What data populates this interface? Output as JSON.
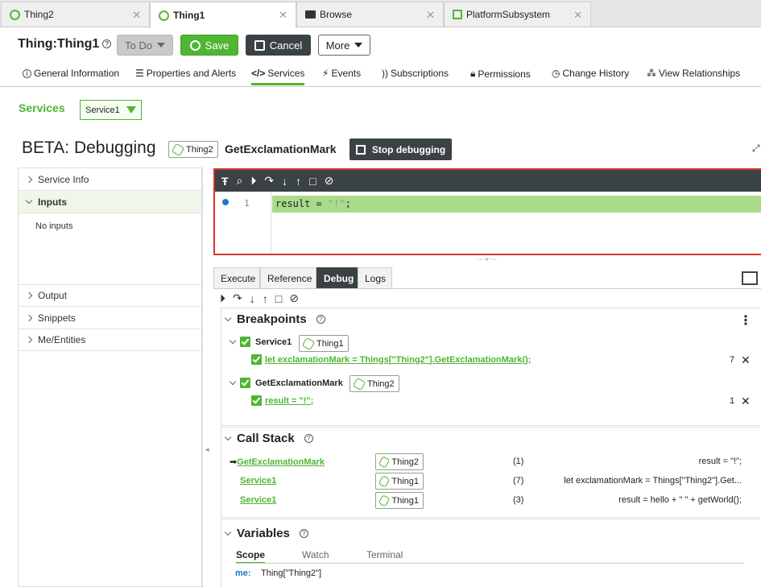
{
  "browser_tabs": [
    {
      "label": "Thing2",
      "icon": "thing-icon",
      "active": false
    },
    {
      "label": "Thing1",
      "icon": "thing-icon",
      "active": true
    },
    {
      "label": "Browse",
      "icon": "folder-icon",
      "active": false
    },
    {
      "label": "PlatformSubsystem",
      "icon": "subsystem-icon",
      "active": false
    }
  ],
  "header": {
    "title": "Thing:Thing1",
    "todo_label": "To Do",
    "save_label": "Save",
    "cancel_label": "Cancel",
    "more_label": "More"
  },
  "subnav": [
    {
      "label": "General Information",
      "icon": "info-icon"
    },
    {
      "label": "Properties and Alerts",
      "icon": "list-icon"
    },
    {
      "label": "Services",
      "icon": "code-icon",
      "active": true
    },
    {
      "label": "Events",
      "icon": "bolt-icon"
    },
    {
      "label": "Subscriptions",
      "icon": "rss-icon"
    },
    {
      "label": "Permissions",
      "icon": "lock-icon"
    },
    {
      "label": "Change History",
      "icon": "clock-icon"
    },
    {
      "label": "View Relationships",
      "icon": "relationship-icon"
    }
  ],
  "services": {
    "label": "Services",
    "selected": "Service1"
  },
  "debug": {
    "title": "BETA: Debugging",
    "thing": "Thing2",
    "method": "GetExclamationMark",
    "stop_label": "Stop debugging"
  },
  "left_panel": {
    "service_info": "Service Info",
    "inputs": "Inputs",
    "no_inputs": "No inputs",
    "output": "Output",
    "snippets": "Snippets",
    "me_entities": "Me/Entities"
  },
  "editor": {
    "line_number": "1",
    "code_prefix": "result = ",
    "code_string": "\"!\"",
    "code_suffix": ";"
  },
  "debug_tabs": [
    "Execute",
    "Reference",
    "Debug",
    "Logs"
  ],
  "breakpoints": {
    "title": "Breakpoints",
    "groups": [
      {
        "service": "Service1",
        "thing": "Thing1",
        "code": "let exclamationMark = Things[\"Thing2\"].GetExclamationMark();",
        "line": "7"
      },
      {
        "service": "GetExclamationMark",
        "thing": "Thing2",
        "code": "result = \"!\";",
        "line": "1"
      }
    ]
  },
  "call_stack": {
    "title": "Call Stack",
    "frames": [
      {
        "name": "GetExclamationMark",
        "thing": "Thing2",
        "line": "(1)",
        "code": "result = \"!\";",
        "current": true
      },
      {
        "name": "Service1",
        "thing": "Thing1",
        "line": "(7)",
        "code": "let exclamationMark = Things[\"Thing2\"].Get...",
        "current": false
      },
      {
        "name": "Service1",
        "thing": "Thing1",
        "line": "(3)",
        "code": "result = hello + \" \" + getWorld();",
        "current": false
      }
    ]
  },
  "variables": {
    "title": "Variables",
    "tabs": [
      "Scope",
      "Watch",
      "Terminal"
    ],
    "rows": [
      {
        "name": "me:",
        "value": "Thing[\"Thing2\"]"
      }
    ]
  },
  "colors": {
    "accent": "#4fb533",
    "dark": "#3b4246",
    "error_border": "#d9342b",
    "highlight": "#a9dc8a"
  }
}
